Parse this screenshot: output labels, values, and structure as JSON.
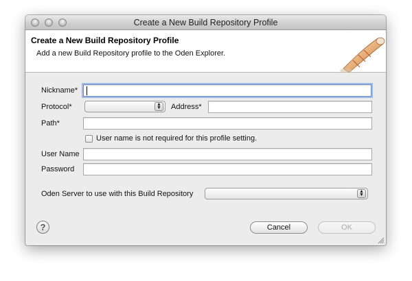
{
  "window": {
    "title": "Create a New Build Repository Profile"
  },
  "banner": {
    "title": "Create a New Build Repository Profile",
    "description": "Add a new Build Repository profile to the Oden Explorer.",
    "icon": "build-repository-banner-icon"
  },
  "form": {
    "nickname_label": "Nickname*",
    "nickname_value": "",
    "protocol_label": "Protocol*",
    "protocol_value": "",
    "address_label": "Address*",
    "address_value": "",
    "path_label": "Path*",
    "path_value": "",
    "no_username_label": "User name is not required for this profile setting.",
    "no_username_checked": false,
    "username_label": "User Name",
    "username_value": "",
    "password_label": "Password",
    "password_value": "",
    "server_label": "Oden Server to use with this Build Repository",
    "server_value": ""
  },
  "footer": {
    "help_icon": "help-icon",
    "help_glyph": "?",
    "cancel_label": "Cancel",
    "ok_label": "OK"
  }
}
